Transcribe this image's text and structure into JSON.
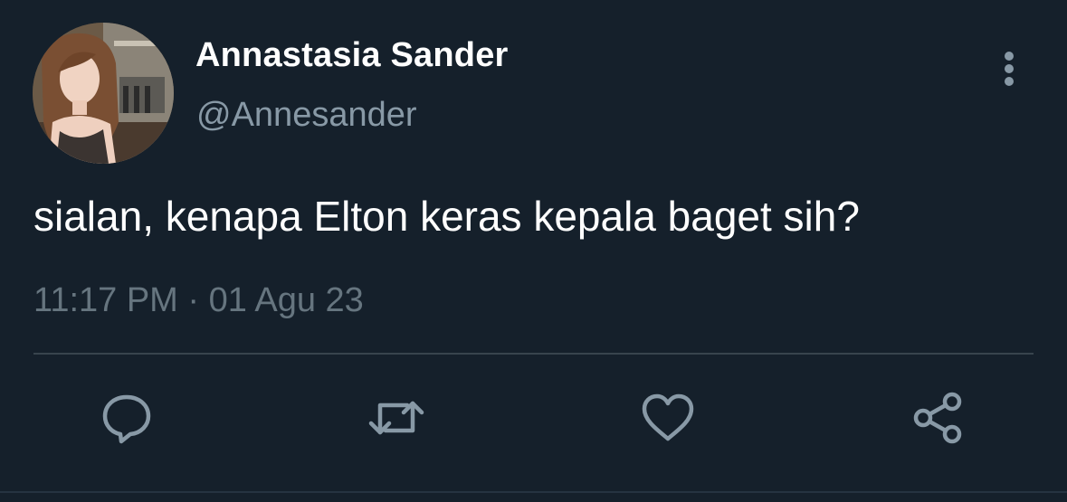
{
  "user": {
    "display_name": "Annastasia Sander",
    "handle": "@Annesander"
  },
  "tweet": {
    "text": "sialan, kenapa Elton keras kepala baget sih?",
    "time": "11:17 PM",
    "separator": "·",
    "date": "01 Agu 23"
  },
  "actions": {
    "items": [
      "reply-icon",
      "retweet-icon",
      "like-icon",
      "share-icon"
    ]
  },
  "colors": {
    "background": "#15202b",
    "text_primary": "#ffffff",
    "text_secondary": "#8899a6",
    "icon": "#8899a6",
    "divider": "#38444d"
  }
}
